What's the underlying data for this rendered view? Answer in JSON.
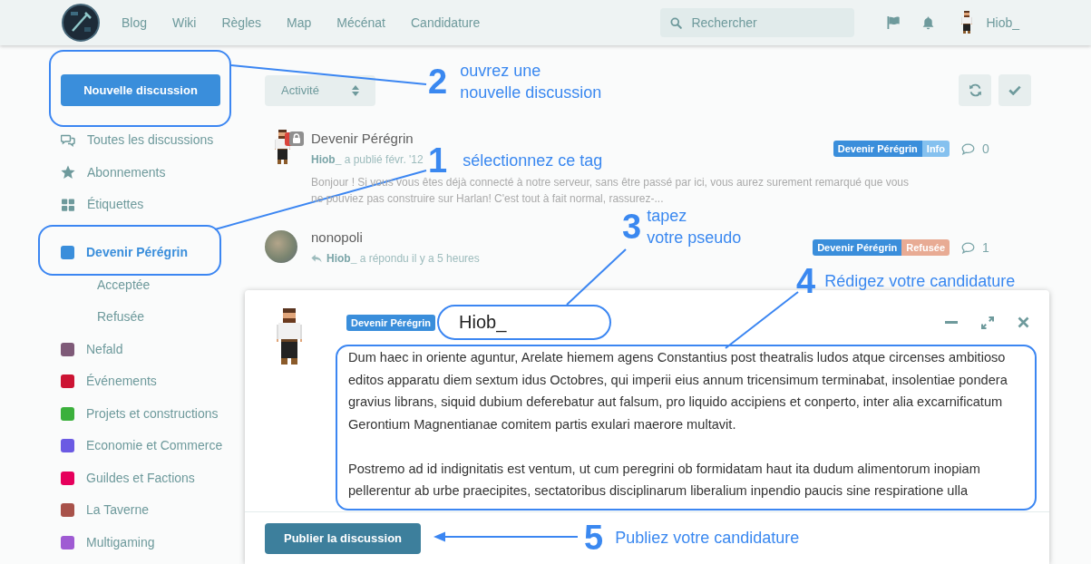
{
  "header": {
    "nav": [
      "Blog",
      "Wiki",
      "Règles",
      "Map",
      "Mécénat",
      "Candidature"
    ],
    "search": {
      "placeholder": "Rechercher"
    },
    "user": {
      "name": "Hiob_"
    }
  },
  "sidebar": {
    "new_discussion": "Nouvelle discussion",
    "links": [
      {
        "label": "Toutes les discussions",
        "selected": false
      },
      {
        "label": "Abonnements",
        "selected": false
      },
      {
        "label": "Étiquettes",
        "selected": false
      }
    ],
    "tags": [
      {
        "label": "Devenir Pérégrin",
        "color": "#3a8edb",
        "selected": true,
        "children": [
          {
            "label": "Acceptée",
            "selected": false
          },
          {
            "label": "Refusée",
            "selected": false
          }
        ]
      },
      {
        "label": "Nefald",
        "color": "#7e5a78",
        "selected": false
      },
      {
        "label": "Événements",
        "color": "#cc1433",
        "selected": false
      },
      {
        "label": "Projets et constructions",
        "color": "#3bb03c",
        "selected": false
      },
      {
        "label": "Economie et Commerce",
        "color": "#6b5ae3",
        "selected": false
      },
      {
        "label": "Guildes et Factions",
        "color": "#e6005c",
        "selected": false
      },
      {
        "label": "La Taverne",
        "color": "#a8524a",
        "selected": false
      },
      {
        "label": "Multigaming",
        "color": "#9f5bd3",
        "selected": false
      }
    ]
  },
  "toolbar": {
    "sort": "Activité"
  },
  "discussions": [
    {
      "title": "Devenir Pérégrin",
      "avatar_photo": false,
      "locked": true,
      "kind": "post",
      "author": "Hiob_",
      "action": "a publié févr. '12",
      "excerpt": "Bonjour ! Si vous vous êtes déjà connecté à notre serveur, sans être passé par ici, vous aurez surement remarqué que vous ne pouviez pas construire sur Harlan! C'est tout à fait normal, rassurez-...",
      "tags": [
        {
          "label": "Devenir Pérégrin",
          "color": "#3a8edb"
        },
        {
          "label": "Info",
          "color": "#85c1ef"
        }
      ],
      "replies": "0"
    },
    {
      "title": "nonopoli",
      "avatar_photo": true,
      "locked": false,
      "kind": "reply",
      "author": "Hiob_",
      "action": "a répondu il y a 5 heures",
      "tags": [
        {
          "label": "Devenir Pérégrin",
          "color": "#3a8edb"
        },
        {
          "label": "Refusée",
          "color": "#e8ab94"
        }
      ],
      "replies": "1"
    }
  ],
  "composer": {
    "tag": {
      "label": "Devenir Pérégrin",
      "color": "#3a8edb"
    },
    "title": "Hiob_",
    "body": "Dum haec in oriente aguntur, Arelate hiemem agens Constantius post theatralis ludos atque circenses ambitioso editos apparatu diem sextum idus Octobres, qui imperii eius annum tricensimum terminabat, insolentiae pondera gravius librans, siquid dubium deferebatur aut falsum, pro liquido accipiens et conperto, inter alia excarnificatum Gerontium Magnentianae comitem partis exulari maerore multavit.\n\nPostremo ad id indignitatis est ventum, ut cum peregrini ob formidatam haut ita dudum alimentorum inopiam pellerentur ab urbe praecipites, sectatoribus disciplinarum liberalium inpendio paucis sine respiratione ulla",
    "submit": "Publier la discussion"
  },
  "annotations": [
    {
      "number": "2",
      "text": "ouvrez une\nnouvelle discussion"
    },
    {
      "number": "1",
      "text": "sélectionnez ce tag"
    },
    {
      "number": "3",
      "text": "tapez\nvotre pseudo"
    },
    {
      "number": "4",
      "text": "Rédigez votre candidature"
    },
    {
      "number": "5",
      "text": "Publiez votre candidature"
    }
  ]
}
